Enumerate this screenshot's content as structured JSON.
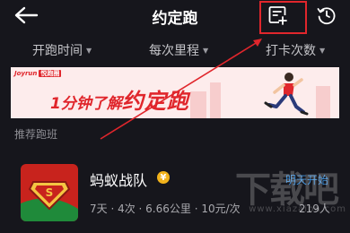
{
  "header": {
    "title": "约定跑"
  },
  "filters": [
    {
      "label": "开跑时间"
    },
    {
      "label": "每次里程"
    },
    {
      "label": "打卡次数"
    }
  ],
  "banner": {
    "logo_en": "Joyrun",
    "logo_cn": "悦跑圈",
    "text_prefix": "1分钟了解",
    "text_emphasis": "约定跑"
  },
  "section": {
    "label": "推荐跑班"
  },
  "team": {
    "name": "蚂蚁战队",
    "verified_glyph": "¥",
    "start_status": "明天开始",
    "meta": "7天 · 4次 · 6.66公里 · 10元/次",
    "count": "219人"
  },
  "watermark": {
    "cn": "下载吧",
    "url": "www.xiazaiba.com"
  },
  "colors": {
    "background": "#16161c",
    "accent_red": "#e0262c",
    "link_blue": "#3a8ed9",
    "badge_gold": "#f1b21b"
  },
  "icons": {
    "back": "arrow-left-icon",
    "new_run": "new-note-plus-icon",
    "history": "clock-history-icon"
  }
}
